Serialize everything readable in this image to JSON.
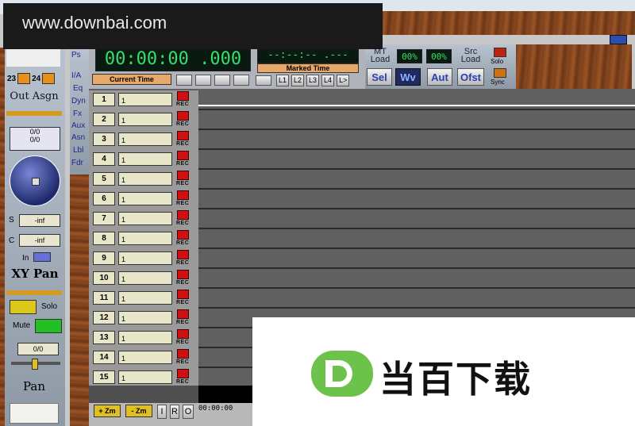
{
  "watermark": {
    "url": "www.downbai.com"
  },
  "brand": {
    "name": "当百下载"
  },
  "left_strip": {
    "ch_a": "23",
    "ch_b": "24",
    "out_assign": "Out Asgn",
    "pan_values": [
      "0/0",
      "0/0"
    ],
    "s_label": "S",
    "s_value": "-inf",
    "c_label": "C",
    "c_value": "-inf",
    "in_label": "In",
    "xy_pan": "XY Pan",
    "solo": "Solo",
    "mute": "Mute",
    "pan_value": "0/0",
    "pan_label": "Pan"
  },
  "side_tabs": [
    "Ps",
    "I/A",
    "Eq",
    "Dyn",
    "Fx",
    "Aux",
    "Asn",
    "Lbl",
    "Fdr"
  ],
  "transport": {
    "current_time": "00:00:00 .000",
    "current_time_label": "Current Time",
    "marked_time": "--:--:-- .---",
    "marked_time_label": "Marked Time",
    "locators": [
      "L1",
      "L2",
      "L3",
      "L4",
      "L>"
    ]
  },
  "mode_buttons": {
    "mt_load": "MT Load",
    "meter1": "00%",
    "meter2": "00%",
    "src_load": "Src Load",
    "solo": "Solo",
    "sync": "Sync",
    "sel": "Sel",
    "wv": "Wv",
    "aut": "Aut",
    "ofst": "Ofst"
  },
  "tracks": [
    {
      "num": "1",
      "name": "1",
      "rec": "REC"
    },
    {
      "num": "2",
      "name": "1",
      "rec": "REC"
    },
    {
      "num": "3",
      "name": "1",
      "rec": "REC"
    },
    {
      "num": "4",
      "name": "1",
      "rec": "REC"
    },
    {
      "num": "5",
      "name": "1",
      "rec": "REC"
    },
    {
      "num": "6",
      "name": "1",
      "rec": "REC"
    },
    {
      "num": "7",
      "name": "1",
      "rec": "REC"
    },
    {
      "num": "8",
      "name": "1",
      "rec": "REC"
    },
    {
      "num": "9",
      "name": "1",
      "rec": "REC"
    },
    {
      "num": "10",
      "name": "1",
      "rec": "REC"
    },
    {
      "num": "11",
      "name": "1",
      "rec": "REC"
    },
    {
      "num": "12",
      "name": "1",
      "rec": "REC"
    },
    {
      "num": "13",
      "name": "1",
      "rec": "REC"
    },
    {
      "num": "14",
      "name": "1",
      "rec": "REC"
    },
    {
      "num": "15",
      "name": "1",
      "rec": "REC"
    }
  ],
  "bottom": {
    "zoom_in": "+ Zm",
    "zoom_out": "- Zm",
    "i": "I",
    "r": "R",
    "o": "O",
    "timecode": "00:00:00"
  },
  "colors": {
    "lcd_green": "#33e06a",
    "rec_red": "#d01010",
    "brand_green": "#6cc24a"
  }
}
